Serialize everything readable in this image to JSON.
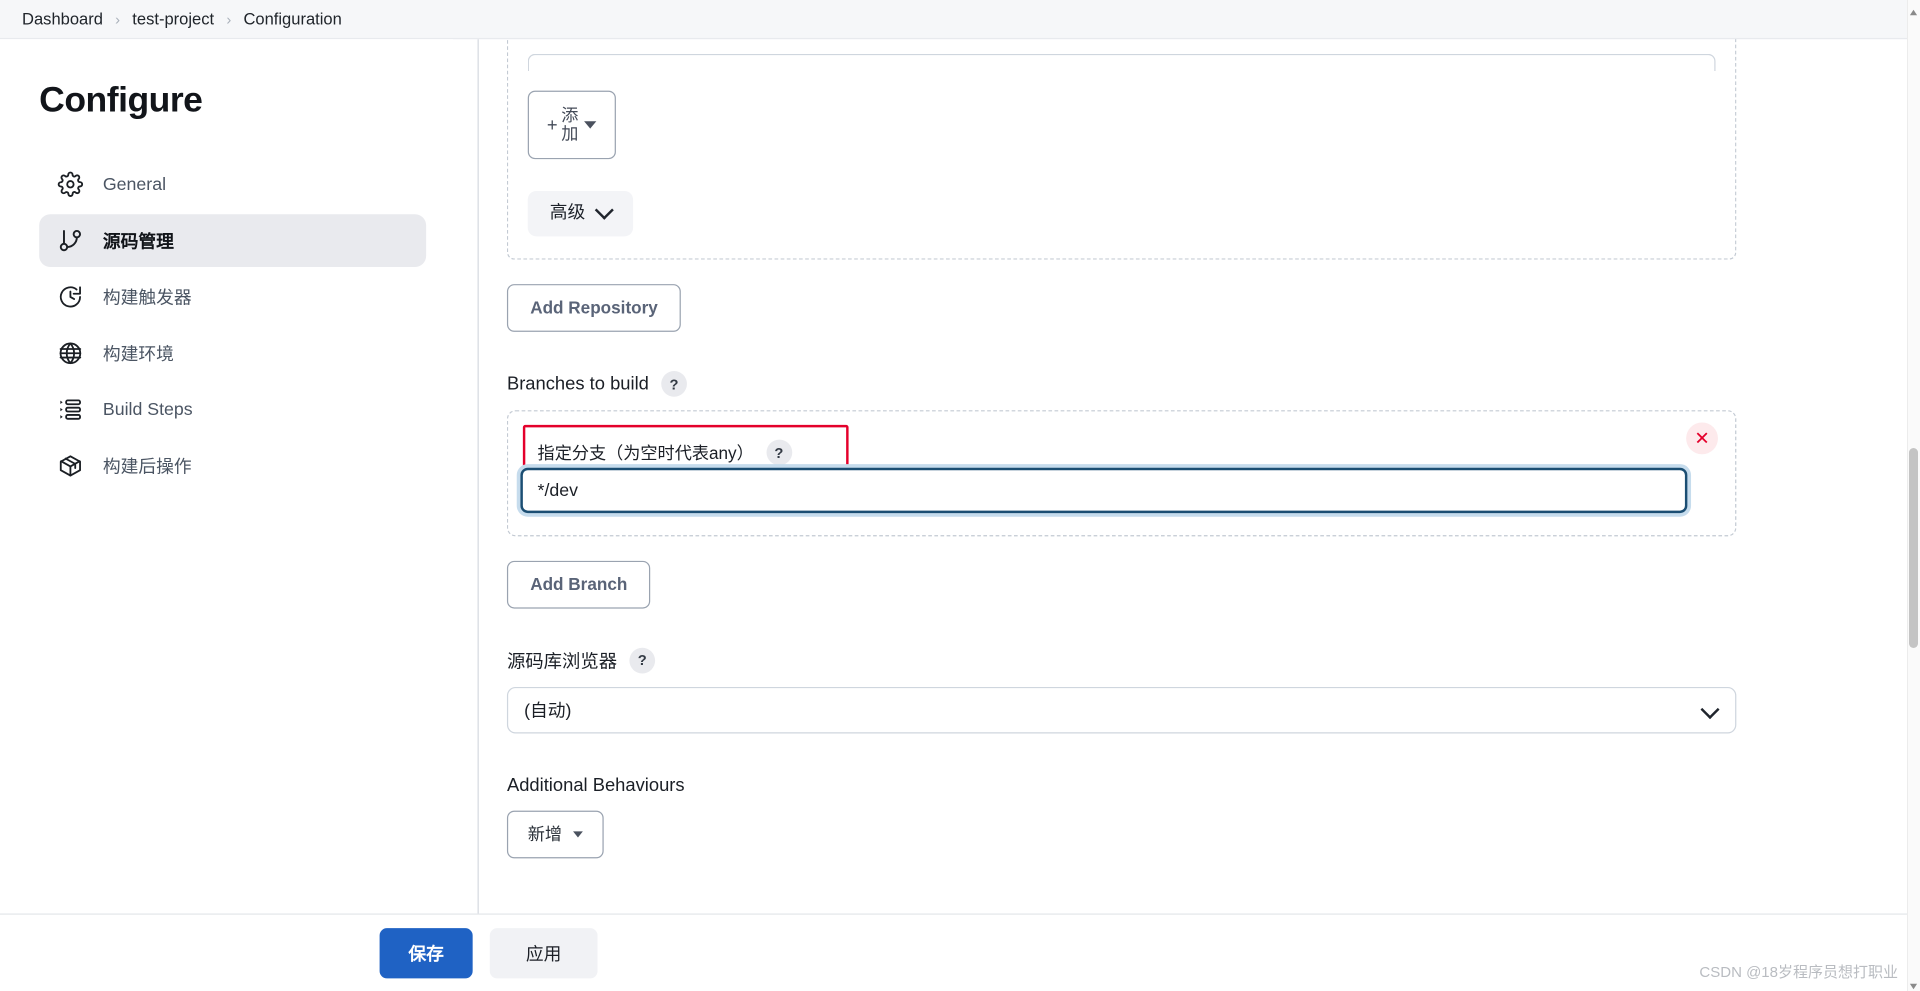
{
  "breadcrumb": {
    "items": [
      {
        "label": "Dashboard"
      },
      {
        "label": "test-project"
      },
      {
        "label": "Configuration"
      }
    ],
    "separator": "›"
  },
  "sidebar": {
    "title": "Configure",
    "items": [
      {
        "label": "General",
        "icon": "gear-icon",
        "active": false
      },
      {
        "label": "源码管理",
        "icon": "git-branch-icon",
        "active": true
      },
      {
        "label": "构建触发器",
        "icon": "clock-icon",
        "active": false
      },
      {
        "label": "构建环境",
        "icon": "globe-icon",
        "active": false
      },
      {
        "label": "Build Steps",
        "icon": "list-steps-icon",
        "active": false
      },
      {
        "label": "构建后操作",
        "icon": "package-icon",
        "active": false
      }
    ]
  },
  "main": {
    "repo_block": {
      "add_button": {
        "plus": "+",
        "line1": "添",
        "line2": "加"
      },
      "advanced_button": "高级"
    },
    "add_repository_button": "Add Repository",
    "branches": {
      "section_label": "Branches to build",
      "section_help": "?",
      "branch_field_label": "指定分支（为空时代表any）",
      "branch_field_help": "?",
      "branch_value": "*/dev",
      "branch_placeholder": "",
      "remove_label": "✕",
      "add_branch_button": "Add Branch"
    },
    "repo_browser": {
      "label": "源码库浏览器",
      "help": "?",
      "selected": "(自动)",
      "options": [
        "(自动)"
      ]
    },
    "additional_behaviours": {
      "label": "Additional Behaviours",
      "add_button": "新增"
    }
  },
  "action_bar": {
    "save_label": "保存",
    "apply_label": "应用"
  },
  "watermark": "CSDN @18岁程序员想打职业",
  "colors": {
    "accent_blue": "#1f62c4",
    "highlight_red": "#e4002b",
    "focus_border": "#1b4e73",
    "sidebar_active_bg": "#e9eaee"
  }
}
